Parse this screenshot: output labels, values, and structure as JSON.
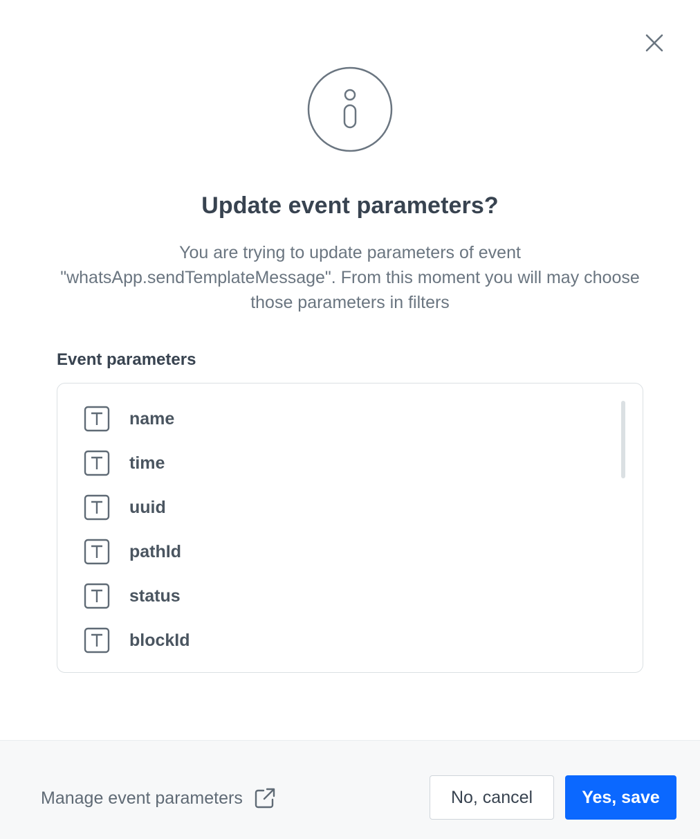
{
  "dialog": {
    "title": "Update event parameters?",
    "description": "You are trying to update parameters of event \"whatsApp.sendTemplateMessage\". From this moment you will may choose those parameters in filters",
    "icons": {
      "header": "info-icon",
      "close": "close-icon"
    }
  },
  "parameters": {
    "label": "Event parameters",
    "type_icon": "text-type-icon",
    "items": [
      {
        "name": "name",
        "type": "T"
      },
      {
        "name": "time",
        "type": "T"
      },
      {
        "name": "uuid",
        "type": "T"
      },
      {
        "name": "pathId",
        "type": "T"
      },
      {
        "name": "status",
        "type": "T"
      },
      {
        "name": "blockId",
        "type": "T"
      }
    ]
  },
  "footer": {
    "manage_label": "Manage event parameters",
    "manage_icon": "external-link-icon",
    "cancel_label": "No, cancel",
    "save_label": "Yes, save"
  },
  "colors": {
    "primary": "#0b68ff",
    "text": "#384350",
    "muted": "#6a7580",
    "border": "#dbe0e3",
    "footer_bg": "#f7f8f9"
  }
}
